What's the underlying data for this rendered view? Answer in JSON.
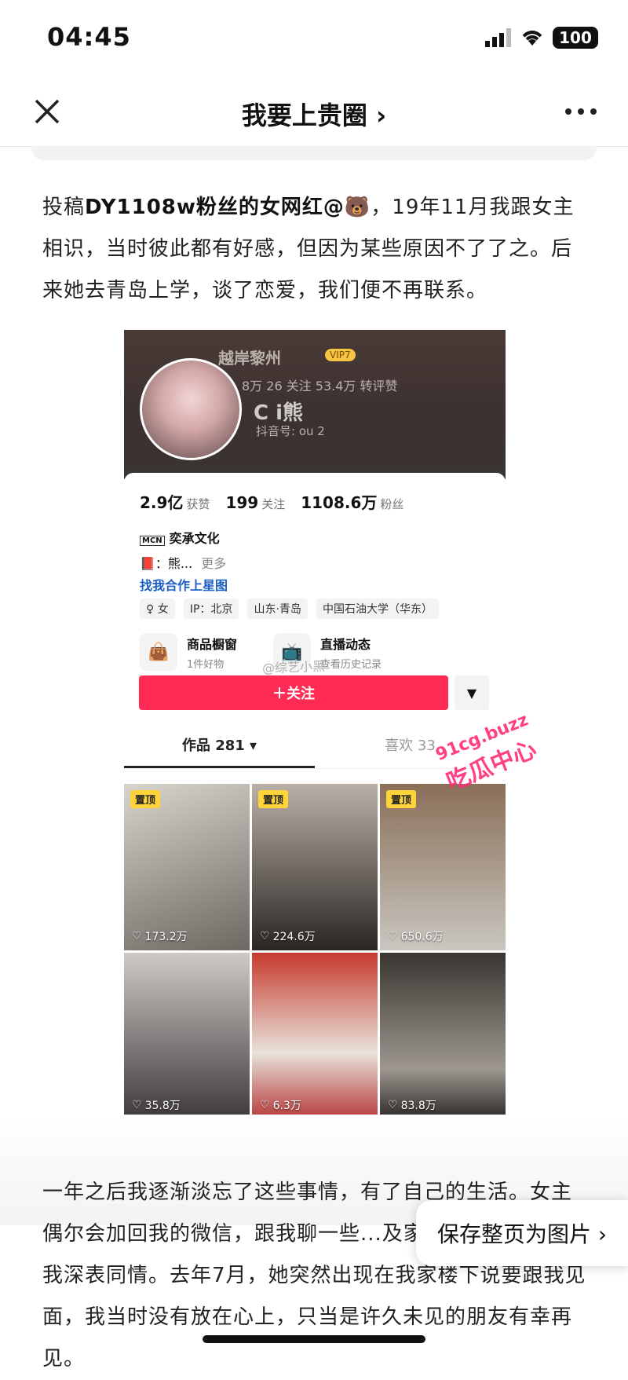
{
  "status": {
    "time": "04:45",
    "battery": "100"
  },
  "nav": {
    "title": "我要上贵圈 ›"
  },
  "article": {
    "p1_prefix": "投稿",
    "p1_bold": "DY1108w粉丝的女网红@🐻",
    "p1_rest": "，19年11月我跟女主相识，当时彼此都有好感，但因为某些原因不了了之。后来她去青岛上学，谈了恋爱，我们便不再联系。",
    "p2": "一年之后我逐渐淡忘了这些事情，有了自己的生活。女主偶尔会加回我的微信，跟我聊一些...及家庭方面的变故，我深表同情。去年7月，她突然出现在我家楼下说要跟我见面，我当时没有放在心上，只当是许久未见的朋友有幸再见。"
  },
  "profile": {
    "banner_name": "越岸黎州",
    "banner_vip": "VIP7",
    "banner_stats": "8万  26 关注  53.4万 转评赞",
    "display_name": "C  i熊",
    "account_id": "抖音号: ou      2",
    "stats": [
      {
        "value": "2.9亿",
        "label": "获赞"
      },
      {
        "value": "199",
        "label": "关注"
      },
      {
        "value": "1108.6万",
        "label": "粉丝"
      }
    ],
    "mcn": "奕承文化",
    "bio": "：熊...",
    "bio_more": "更多",
    "star_link": "找我合作上星图",
    "tags": [
      "♀ 女",
      "IP：北京",
      "山东·青岛",
      "中国石油大学（华东）"
    ],
    "shop_title": "商品橱窗",
    "shop_sub": "1件好物",
    "live_title": "直播动态",
    "live_sub": "查看历史记录",
    "watermark": "@综艺小黑",
    "follow_label": "＋关注",
    "tab_works": "作品 281 ▾",
    "tab_likes": "喜欢 33",
    "pin_label": "置顶",
    "videos": [
      {
        "likes": "173.2万",
        "pinned": true
      },
      {
        "likes": "224.6万",
        "pinned": true
      },
      {
        "likes": "650.6万",
        "pinned": true
      },
      {
        "likes": "35.8万",
        "pinned": false
      },
      {
        "likes": "6.3万",
        "pinned": false
      },
      {
        "likes": "83.8万",
        "pinned": false
      }
    ]
  },
  "brand_overlay": {
    "url": "91cg.buzz",
    "cn": "吃瓜中心"
  },
  "save_button": "保存整页为图片 ›"
}
